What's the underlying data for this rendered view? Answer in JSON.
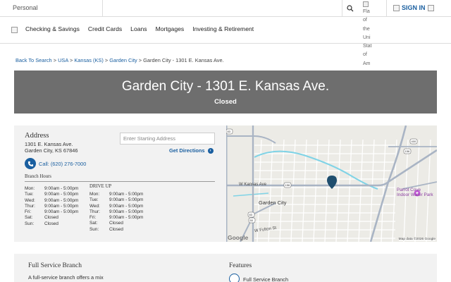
{
  "topbar": {
    "segment": "Personal",
    "flag_alt_lines": [
      "Fla",
      "of",
      "the",
      "Uni",
      "Stat",
      "of",
      "Am"
    ],
    "signin": "SIGN IN"
  },
  "nav": {
    "items": [
      "Checking & Savings",
      "Credit Cards",
      "Loans",
      "Mortgages",
      "Investing & Retirement"
    ]
  },
  "breadcrumb": {
    "items": [
      "Back To Search",
      "USA",
      "Kansas (KS)",
      "Garden City"
    ],
    "current": "Garden City - 1301 E. Kansas Ave.",
    "separator": ">"
  },
  "hero": {
    "title": "Garden City - 1301 E. Kansas Ave.",
    "status": "Closed"
  },
  "address": {
    "heading": "Address",
    "line1": "1301 E. Kansas Ave.",
    "line2": "Garden City, KS 67846",
    "start_placeholder": "Enter Starting Address",
    "directions": "Get Directions",
    "call": "Call: (620) 276-7000"
  },
  "hours": {
    "branch_heading": "Branch Hours",
    "drive_heading": "DRIVE UP",
    "branch": [
      {
        "day": "Mon:",
        "time": "9:00am - 5:00pm"
      },
      {
        "day": "Tue:",
        "time": "9:00am - 5:00pm"
      },
      {
        "day": "Wed:",
        "time": "9:00am - 5:00pm"
      },
      {
        "day": "Thur:",
        "time": "9:00am - 5:00pm"
      },
      {
        "day": "Fri:",
        "time": "9:00am - 5:00pm"
      },
      {
        "day": "Sat:",
        "time": "Closed"
      },
      {
        "day": "Sun:",
        "time": "Closed"
      }
    ],
    "drive": [
      {
        "day": "Mon:",
        "time": "9:00am - 5:00pm"
      },
      {
        "day": "Tue:",
        "time": "9:00am - 5:00pm"
      },
      {
        "day": "Wed:",
        "time": "9:00am - 5:00pm"
      },
      {
        "day": "Thur:",
        "time": "9:00am - 5:00pm"
      },
      {
        "day": "Fri:",
        "time": "9:00am - 5:00pm"
      },
      {
        "day": "Sat:",
        "time": "Closed"
      },
      {
        "day": "Sun:",
        "time": "Closed"
      }
    ]
  },
  "map": {
    "street": "W Kansas Ave",
    "city": "Garden City",
    "park": [
      "Parrot Cove",
      "Indoor Water Park"
    ],
    "street2": "W Fulton St",
    "shields": [
      "83",
      "156",
      "156",
      "400",
      "83",
      "50"
    ],
    "attribution": "Map data ©2026 Google",
    "logo": "Google",
    "colors": {
      "road": "#a9b4c4",
      "water": "#7fd3e6",
      "pin": "#1f4e6e"
    }
  },
  "branch": {
    "heading": "Full Service Branch",
    "text": "A full-service branch offers a mix",
    "features_heading": "Features",
    "feature1": "Full Service Branch"
  },
  "colors": {
    "brand": "#1a5fa0",
    "hero": "#6e6e6e"
  }
}
